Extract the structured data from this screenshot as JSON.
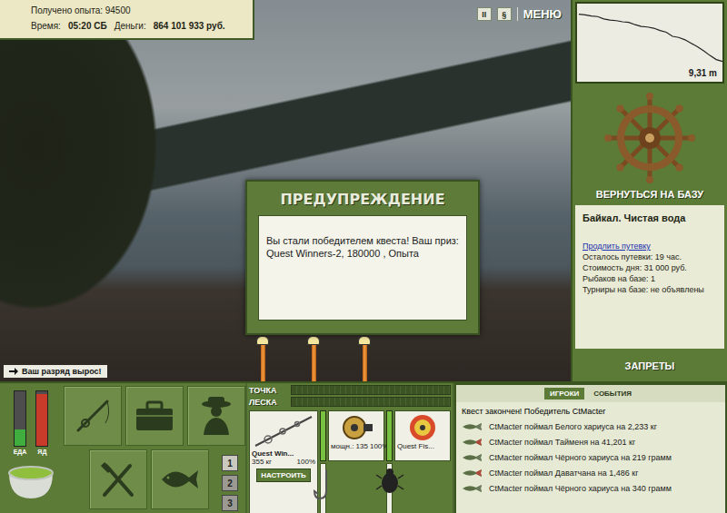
{
  "stats": {
    "experience": "Получено опыта: 94500",
    "time_label": "Время:",
    "time": "05:20 СБ",
    "money_label": "Деньги:",
    "money": "864 101 933 руб."
  },
  "top_buttons": {
    "pause": "II",
    "sound": "§",
    "menu": "МЕНЮ"
  },
  "dialog": {
    "title": "ПРЕДУПРЕЖДЕНИЕ",
    "message": "Вы стали победителем квеста! Ваш приз: Quest Winners-2, 180000 , Опыта"
  },
  "notice": "Ваш разряд вырос!",
  "rods": [
    {
      "lit": true
    },
    {
      "lit": true
    },
    {
      "lit": true
    }
  ],
  "depth": {
    "reading": "9,31 m",
    "values": [
      1.2,
      1.3,
      1.5,
      1.6,
      2.0,
      2.2,
      2.3,
      2.5,
      2.6,
      3.0,
      3.3,
      3.4,
      3.6,
      4.0,
      4.3,
      5.0,
      5.2,
      5.6,
      6.2,
      6.8,
      7.5,
      8.3,
      9.0,
      9.31
    ]
  },
  "sidebar": {
    "return_label": "ВЕРНУТЬСЯ НА БАЗУ",
    "location": "Байкал. Чистая вода",
    "extend_link": "Продлить путевку",
    "details": [
      "Осталось путевки: 19 час.",
      "Стоимость дня: 31 000 руб.",
      "Рыбаков на базе: 1",
      "Турниры на базе: не объявлены"
    ],
    "bans_label": "ЗАПРЕТЫ"
  },
  "meters": [
    {
      "label": "ЕДА",
      "level": 0.3,
      "color": "#3fae3f"
    },
    {
      "label": "ЯД",
      "level": 0.95,
      "color": "#c83a2a"
    }
  ],
  "slots": [
    {
      "label": "1",
      "selected": true
    },
    {
      "label": "2",
      "selected": false
    },
    {
      "label": "3",
      "selected": false
    }
  ],
  "tackle": {
    "bars": [
      {
        "label": "ТОЧКА",
        "level": 0
      },
      {
        "label": "ЛЕСКА",
        "level": 0
      }
    ],
    "rod": {
      "name": "Quest Win...",
      "load": "355 кг",
      "level": 1,
      "reading": "100%",
      "button": "НАСТРОИТЬ"
    },
    "reel": {
      "caption": "мощн.: 135",
      "level": 1,
      "reading": "100%"
    },
    "line": {
      "caption": "Quest Fis..."
    }
  },
  "chat": {
    "tabs": [
      {
        "label": "ИГРОКИ",
        "selected": true
      },
      {
        "label": "СОБЫТИЯ",
        "selected": false
      }
    ],
    "messages": [
      {
        "kind": "system",
        "text": "Квест закончен! Победитель CtMacter",
        "color": "#000000"
      },
      {
        "kind": "catch",
        "text": "CtMacter поймал Белого хариуса на 2,233 кг",
        "color": "#6b7a5a"
      },
      {
        "kind": "catch",
        "text": "CtMacter поймал Тайменя на 41,201 кг",
        "color": "#b04a3a"
      },
      {
        "kind": "catch",
        "text": "CtMacter поймал Чёрного хариуса на 219 грамм",
        "color": "#6b7a5a"
      },
      {
        "kind": "catch",
        "text": "CtMacter поймал Даватчана на 1,486 кг",
        "color": "#b04a3a"
      },
      {
        "kind": "catch",
        "text": "CtMacter поймал Чёрного хариуса на 340 грамм",
        "color": "#6b7a5a"
      }
    ]
  }
}
